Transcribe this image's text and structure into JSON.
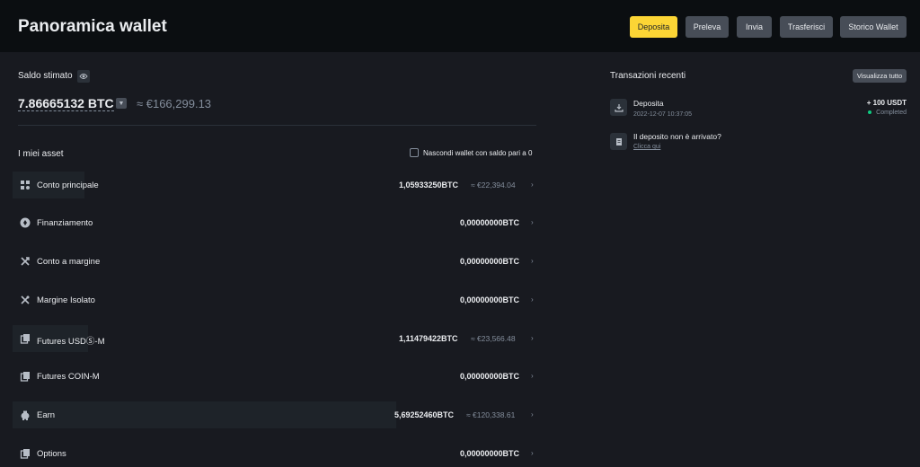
{
  "header": {
    "title": "Panoramica wallet",
    "buttons": [
      "Deposita",
      "Preleva",
      "Invia",
      "Trasferisci",
      "Storico Wallet"
    ]
  },
  "balance": {
    "label": "Saldo stimato",
    "btc": "7.86665132 BTC",
    "fiat": "≈ €166,299.13"
  },
  "assets": {
    "title": "I miei asset",
    "hide_zero_label": "Nascondi wallet con saldo pari a 0",
    "rows": [
      {
        "name": "Conto principale",
        "btc": "1,05933250BTC",
        "fiat": "≈ €22,394.04"
      },
      {
        "name": "Finanziamento",
        "btc": "0,00000000BTC",
        "fiat": ""
      },
      {
        "name": "Conto a margine",
        "btc": "0,00000000BTC",
        "fiat": ""
      },
      {
        "name": "Margine Isolato",
        "btc": "0,00000000BTC",
        "fiat": ""
      },
      {
        "name": "Futures USDⓈ-M",
        "btc": "1,11479422BTC",
        "fiat": "≈ €23,566.48"
      },
      {
        "name": "Futures COIN-M",
        "btc": "0,00000000BTC",
        "fiat": ""
      },
      {
        "name": "Earn",
        "btc": "5,69252460BTC",
        "fiat": "≈ €120,338.61"
      },
      {
        "name": "Options",
        "btc": "0,00000000BTC",
        "fiat": ""
      }
    ]
  },
  "recent": {
    "title": "Transazioni recenti",
    "view_all": "Visualizza tutto",
    "tx": {
      "title": "Deposita",
      "date": "2022-12-07 10:37:05",
      "amount": "+ 100 USDT",
      "status": "Completed"
    },
    "help": {
      "title": "Il deposito non è arrivato?",
      "link": "Clicca qui"
    }
  },
  "colors": {
    "background": "#181a20",
    "topbar": "#0b0e11",
    "accent": "#fcd535",
    "success": "#0ecb81",
    "muted": "#848e9c"
  }
}
